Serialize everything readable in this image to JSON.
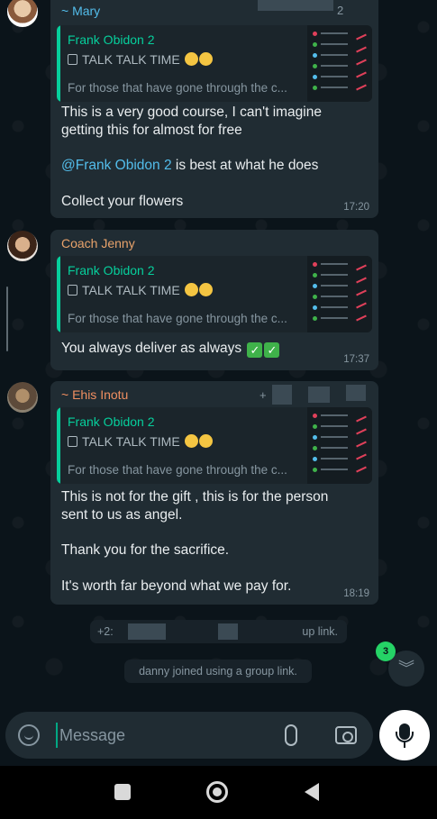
{
  "messages": [
    {
      "sender": "~ Mary",
      "quote": {
        "name": "Frank Obidon 2",
        "title": "TALK TALK TIME",
        "desc": "For those that have gone through the c..."
      },
      "line1": "This is a very good course, I can't imagine",
      "line2": "getting this for almost for free",
      "mention": "@Frank Obidon 2",
      "mention_rest": " is best at what he does",
      "line4": "Collect your flowers",
      "time": "17:20",
      "header_partial": "2"
    },
    {
      "sender": "Coach Jenny",
      "quote": {
        "name": "Frank Obidon 2",
        "title": "TALK TALK TIME",
        "desc": "For those that have gone through the c..."
      },
      "text": "You always deliver as always",
      "time": "17:37"
    },
    {
      "sender": "~ Ehis Inotu",
      "phone_partial": "+",
      "quote": {
        "name": "Frank Obidon 2",
        "title": "TALK TALK TIME",
        "desc": "For those that have gone through the c..."
      },
      "line1": "This is not for the gift , this is for the person",
      "line2": "sent to us as angel.",
      "line3": "Thank you for the sacrifice.",
      "line4": "It's worth far beyond what we pay for.",
      "time": "18:19"
    }
  ],
  "system_messages": {
    "partial_prefix": "+2:",
    "partial_suffix": "up link.",
    "joined": "danny joined using a group link."
  },
  "unread_count": "3",
  "composer": {
    "placeholder": "Message"
  },
  "colors": {
    "accent": "#00a884",
    "quote_bar": "#06cf9c",
    "bubble": "#202c33",
    "background": "#0b141a"
  },
  "icons": [
    "sticker-icon",
    "paperclip-icon",
    "camera-icon",
    "mic-icon",
    "double-chevron-down-icon",
    "nav-recents-icon",
    "nav-home-icon",
    "nav-back-icon"
  ]
}
